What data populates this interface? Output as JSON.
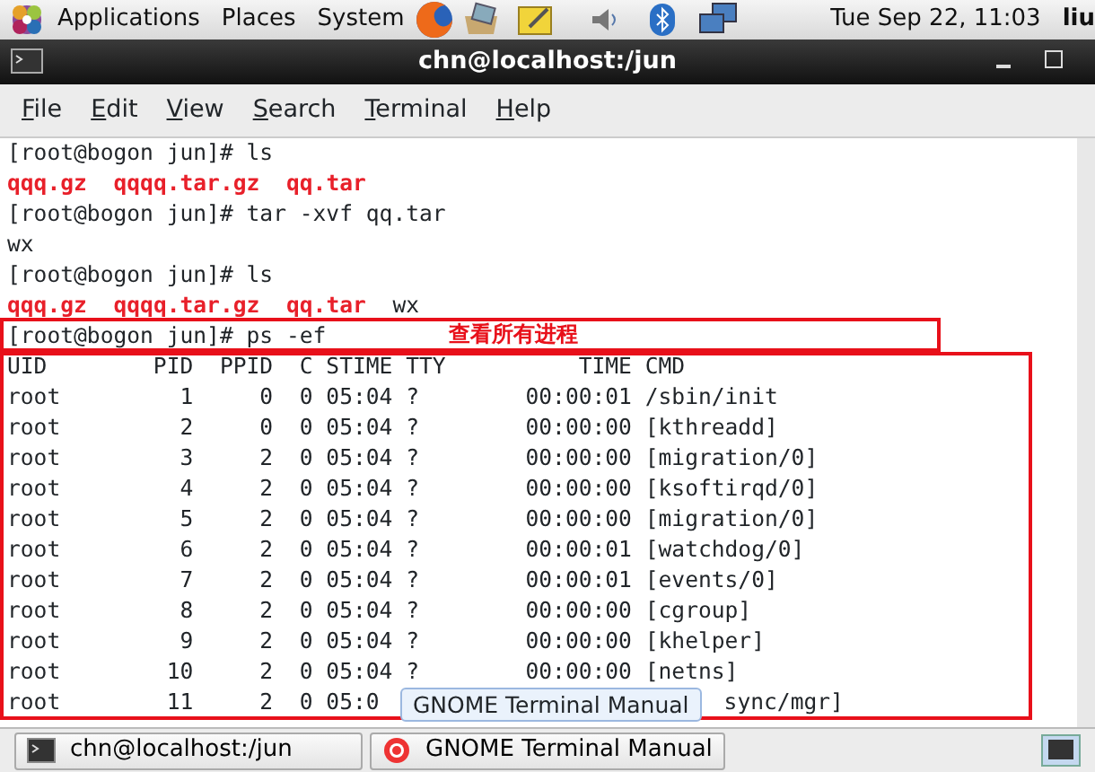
{
  "top_panel": {
    "menus": [
      "Applications",
      "Places",
      "System"
    ],
    "clock": "Tue Sep 22, 11:03",
    "user": "liu"
  },
  "window": {
    "title": "chn@localhost:/jun"
  },
  "menu_bar": [
    "File",
    "Edit",
    "View",
    "Search",
    "Terminal",
    "Help"
  ],
  "terminal": {
    "lines": [
      {
        "kind": "text",
        "text": "[root@bogon jun]# ls"
      },
      {
        "kind": "files",
        "items": [
          {
            "name": "qqq.gz",
            "archive": true
          },
          {
            "name": "qqqq.tar.gz",
            "archive": true
          },
          {
            "name": "qq.tar",
            "archive": true
          }
        ]
      },
      {
        "kind": "text",
        "text": "[root@bogon jun]# tar -xvf qq.tar"
      },
      {
        "kind": "text",
        "text": "wx"
      },
      {
        "kind": "text",
        "text": "[root@bogon jun]# ls"
      },
      {
        "kind": "files",
        "items": [
          {
            "name": "qqq.gz",
            "archive": true
          },
          {
            "name": "qqqq.tar.gz",
            "archive": true
          },
          {
            "name": "qq.tar",
            "archive": true
          },
          {
            "name": "wx",
            "archive": false
          }
        ]
      },
      {
        "kind": "text",
        "text": "[root@bogon jun]# ps -ef"
      },
      {
        "kind": "text",
        "text": "UID        PID  PPID  C STIME TTY          TIME CMD"
      },
      {
        "kind": "text",
        "text": "root         1     0  0 05:04 ?        00:00:01 /sbin/init"
      },
      {
        "kind": "text",
        "text": "root         2     0  0 05:04 ?        00:00:00 [kthreadd]"
      },
      {
        "kind": "text",
        "text": "root         3     2  0 05:04 ?        00:00:00 [migration/0]"
      },
      {
        "kind": "text",
        "text": "root         4     2  0 05:04 ?        00:00:00 [ksoftirqd/0]"
      },
      {
        "kind": "text",
        "text": "root         5     2  0 05:04 ?        00:00:00 [migration/0]"
      },
      {
        "kind": "text",
        "text": "root         6     2  0 05:04 ?        00:00:01 [watchdog/0]"
      },
      {
        "kind": "text",
        "text": "root         7     2  0 05:04 ?        00:00:01 [events/0]"
      },
      {
        "kind": "text",
        "text": "root         8     2  0 05:04 ?        00:00:00 [cgroup]"
      },
      {
        "kind": "text",
        "text": "root         9     2  0 05:04 ?        00:00:00 [khelper]"
      },
      {
        "kind": "text",
        "text": "root        10     2  0 05:04 ?        00:00:00 [netns]"
      },
      {
        "kind": "split",
        "before": "root        11     2  0 05:0",
        "after": "sync/mgr]"
      }
    ],
    "annotation": "查看所有进程",
    "tooltip": "GNOME Terminal Manual"
  },
  "taskbar": [
    {
      "label": "chn@localhost:/jun",
      "kind": "terminal",
      "selected": false
    },
    {
      "label": "GNOME Terminal Manual",
      "kind": "help",
      "selected": false
    }
  ]
}
